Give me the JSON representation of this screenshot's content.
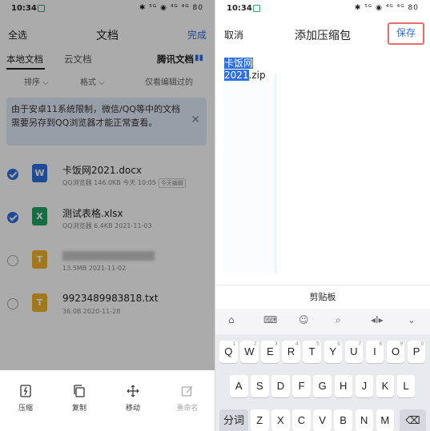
{
  "status": {
    "time": "10:34",
    "icons": "✱ ⁵ᴳ ◉ ⁴ᴳ ⁴ᴳ 80"
  },
  "left": {
    "header": {
      "select_all": "全选",
      "title": "文档",
      "done": "完成"
    },
    "tabs": [
      "本地文档",
      "云文档",
      "腾讯文档"
    ],
    "filters": [
      "排序 ⌵",
      "格式 ⌵",
      "仅看编辑过的"
    ],
    "notice": "由于安卓11系统限制，微信/QQ等中的文档需要另存到QQ浏览器才能正常查看。",
    "files": [
      {
        "name": "卡饭网2021.docx",
        "meta": "QQ浏览器 146.0KB 今天 10:05",
        "tag": "今天编辑",
        "icon_letter": "W",
        "icon_color": "#2f6fe0",
        "checked": true
      },
      {
        "name": "测试表格.xlsx",
        "meta": "QQ浏览器 6.4KB 2021-11-03",
        "icon_letter": "X",
        "icon_color": "#21a366",
        "checked": true
      },
      {
        "name": "",
        "meta": "13.5MB 2021-11-02",
        "icon_letter": "T",
        "icon_color": "#f2b32c",
        "checked": false,
        "blurred": true
      },
      {
        "name": "9923489983818.txt",
        "meta": "36.0B 2020-11-28",
        "icon_letter": "T",
        "icon_color": "#f2b32c",
        "checked": false
      }
    ],
    "bottom_actions": [
      {
        "label": "压缩",
        "icon": "zip-icon"
      },
      {
        "label": "复制",
        "icon": "copy-icon"
      },
      {
        "label": "移动",
        "icon": "move-icon"
      },
      {
        "label": "重命名",
        "icon": "rename-icon",
        "disabled": true
      }
    ]
  },
  "right": {
    "header": {
      "cancel": "取消",
      "title": "添加压缩包",
      "save": "保存"
    },
    "filename_selected": "卡饭网2021",
    "filename_ext": ".zip",
    "clipboard": "剪贴板",
    "kb_tools": [
      "⌂",
      "⌨",
      "☺",
      "⌕",
      "◂I▸",
      "⌄"
    ],
    "rows": [
      [
        [
          "Q",
          "1"
        ],
        [
          "W",
          "2"
        ],
        [
          "E",
          "3"
        ],
        [
          "R",
          "4"
        ],
        [
          "T",
          "5"
        ],
        [
          "Y",
          "6"
        ],
        [
          "U",
          "7"
        ],
        [
          "I",
          "8"
        ],
        [
          "O",
          "9"
        ],
        [
          "P",
          "0"
        ]
      ],
      [
        [
          "A",
          ""
        ],
        [
          "S",
          ""
        ],
        [
          "D",
          ""
        ],
        [
          "F",
          ""
        ],
        [
          "G",
          ""
        ],
        [
          "H",
          ""
        ],
        [
          "J",
          ""
        ],
        [
          "K",
          ""
        ],
        [
          "L",
          ""
        ]
      ],
      [
        [
          "Z",
          ""
        ],
        [
          "X",
          ""
        ],
        [
          "C",
          ""
        ],
        [
          "V",
          ""
        ],
        [
          "B",
          ""
        ],
        [
          "N",
          ""
        ],
        [
          "M",
          ""
        ]
      ]
    ],
    "key_fn_left": "分词",
    "key_backspace": "⌫"
  }
}
